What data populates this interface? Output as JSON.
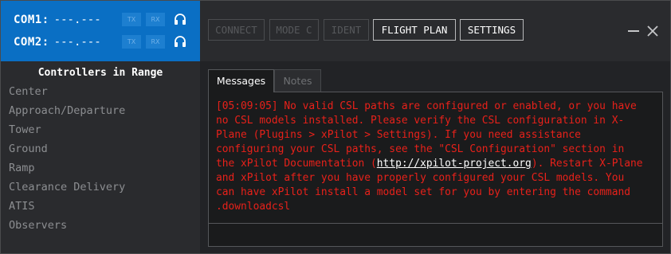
{
  "com": [
    {
      "label": "COM1:",
      "freq": "---.---",
      "tx": "TX",
      "rx": "RX"
    },
    {
      "label": "COM2:",
      "freq": "---.---",
      "tx": "TX",
      "rx": "RX"
    }
  ],
  "controllers": {
    "title": "Controllers in Range",
    "items": [
      "Center",
      "Approach/Departure",
      "Tower",
      "Ground",
      "Ramp",
      "Clearance Delivery",
      "ATIS",
      "Observers"
    ]
  },
  "toolbar": {
    "buttons": [
      {
        "label": "CONNECT",
        "enabled": false
      },
      {
        "label": "MODE C",
        "enabled": false
      },
      {
        "label": "IDENT",
        "enabled": false
      },
      {
        "label": "FLIGHT PLAN",
        "enabled": true
      },
      {
        "label": "SETTINGS",
        "enabled": true
      }
    ]
  },
  "tabs": [
    {
      "label": "Messages",
      "active": true
    },
    {
      "label": "Notes",
      "active": false
    }
  ],
  "message": {
    "line1": "[05:09:05] No valid CSL paths are configured or enabled, or you have",
    "line2": "no CSL models installed. Please verify the CSL configuration in X-",
    "line3": "Plane (Plugins > xPilot > Settings). If you need assistance",
    "line4": "configuring your CSL paths, see the \"CSL Configuration\" section in",
    "line5_pre": "the xPilot Documentation (",
    "link": "http://xpilot-project.org",
    "line5_post": "). Restart X-Plane",
    "line6": "and xPilot after you have properly configured your CSL models. You",
    "line7": "can have xPilot install a model set for you by entering the command",
    "line8": ".downloadcsl"
  },
  "colors": {
    "com_panel": "#0a6fc4",
    "message_text": "#e8211a",
    "link": "#ffffff"
  },
  "icons": [
    "headset-icon",
    "minimize-icon",
    "close-icon"
  ]
}
